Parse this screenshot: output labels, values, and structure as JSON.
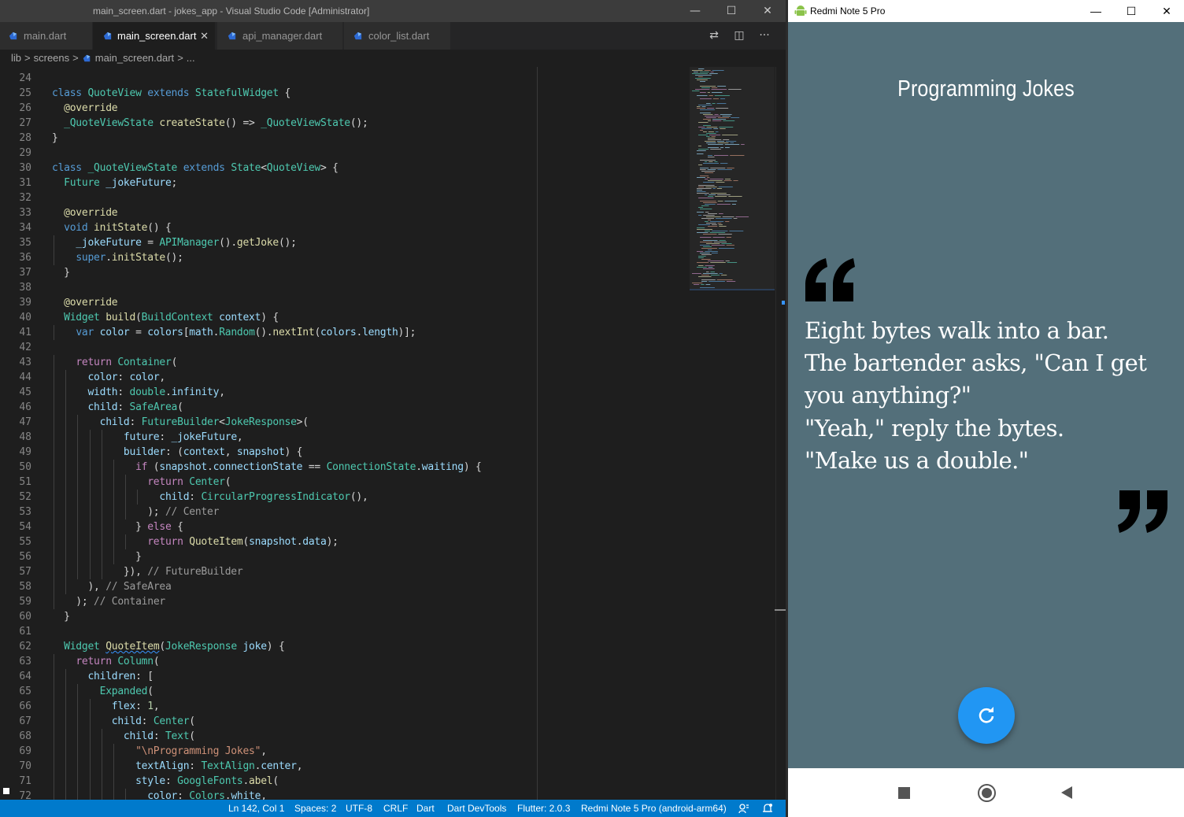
{
  "vscode": {
    "window_title": "main_screen.dart - jokes_app - Visual Studio Code [Administrator]",
    "controls": {
      "minimize": "—",
      "maximize": "☐",
      "close": "✕"
    },
    "tabs": [
      {
        "label": "main.dart",
        "active": false
      },
      {
        "label": "main_screen.dart",
        "active": true,
        "close": "✕"
      },
      {
        "label": "api_manager.dart",
        "active": false
      },
      {
        "label": "color_list.dart",
        "active": false
      }
    ],
    "tab_actions": {
      "compare": "⇄",
      "split": "◫",
      "more": "···"
    },
    "breadcrumb": {
      "folder1": "lib",
      "folder2": "screens",
      "file": "main_screen.dart",
      "tail": "...",
      "sep": ">"
    },
    "status": {
      "position": "Ln 142, Col 1",
      "spaces": "Spaces: 2",
      "encoding": "UTF-8",
      "eol": "CRLF",
      "language": "Dart",
      "devtools": "Dart DevTools",
      "flutter": "Flutter: 2.0.3",
      "device": "Redmi Note 5 Pro (android-arm64)",
      "feedback_icon": "feedback-icon",
      "notifications_icon": "bell-icon"
    },
    "code_lines": [
      {
        "n": "24",
        "html": ""
      },
      {
        "n": "25",
        "html": "<span class=\"kw\">class</span> <span class=\"ty\">QuoteView</span> <span class=\"kw\">extends</span> <span class=\"ty\">StatefulWidget</span> {"
      },
      {
        "n": "26",
        "html": "  <span class=\"an\">@override</span>"
      },
      {
        "n": "27",
        "html": "  <span class=\"ty\">_QuoteViewState</span> <span class=\"fn\">createState</span>() =&gt; <span class=\"ty\">_QuoteViewState</span>();"
      },
      {
        "n": "28",
        "html": "}"
      },
      {
        "n": "29",
        "html": ""
      },
      {
        "n": "30",
        "html": "<span class=\"kw\">class</span> <span class=\"ty\">_QuoteViewState</span> <span class=\"kw\">extends</span> <span class=\"ty\">State</span>&lt;<span class=\"ty\">QuoteView</span>&gt; {"
      },
      {
        "n": "31",
        "html": "  <span class=\"ty\">Future</span> <span class=\"vr\">_jokeFuture</span>;"
      },
      {
        "n": "32",
        "html": ""
      },
      {
        "n": "33",
        "html": "  <span class=\"an\">@override</span>"
      },
      {
        "n": "34",
        "html": "  <span class=\"kw\">void</span> <span class=\"fn\">initState</span>() {"
      },
      {
        "n": "35",
        "html": "    <span class=\"vr\">_jokeFuture</span> = <span class=\"ty\">APIManager</span>().<span class=\"fn\">getJoke</span>();"
      },
      {
        "n": "36",
        "html": "    <span class=\"kw\">super</span>.<span class=\"fn\">initState</span>();"
      },
      {
        "n": "37",
        "html": "  }"
      },
      {
        "n": "38",
        "html": ""
      },
      {
        "n": "39",
        "html": "  <span class=\"an\">@override</span>"
      },
      {
        "n": "40",
        "html": "  <span class=\"ty\">Widget</span> <span class=\"fn\">build</span>(<span class=\"ty\">BuildContext</span> <span class=\"vr\">context</span>) {"
      },
      {
        "n": "41",
        "html": "    <span class=\"kw\">var</span> <span class=\"vr\">color</span> = <span class=\"vr\">colors</span>[<span class=\"vr\">math</span>.<span class=\"ty\">Random</span>().<span class=\"fn\">nextInt</span>(<span class=\"vr\">colors</span>.<span class=\"vr\">length</span>)];"
      },
      {
        "n": "42",
        "html": ""
      },
      {
        "n": "43",
        "html": "    <span class=\"ctl\">return</span> <span class=\"ty\">Container</span>("
      },
      {
        "n": "44",
        "html": "      <span class=\"vr\">color</span>: <span class=\"vr\">color</span>,"
      },
      {
        "n": "45",
        "html": "      <span class=\"vr\">width</span>: <span class=\"ty\">double</span>.<span class=\"vr\">infinity</span>,"
      },
      {
        "n": "46",
        "html": "      <span class=\"vr\">child</span>: <span class=\"ty\">SafeArea</span>("
      },
      {
        "n": "47",
        "html": "        <span class=\"vr\">child</span>: <span class=\"ty\">FutureBuilder</span>&lt;<span class=\"ty\">JokeResponse</span>&gt;("
      },
      {
        "n": "48",
        "html": "            <span class=\"vr\">future</span>: <span class=\"vr\">_jokeFuture</span>,"
      },
      {
        "n": "49",
        "html": "            <span class=\"vr\">builder</span>: (<span class=\"vr\">context</span>, <span class=\"vr\">snapshot</span>) {"
      },
      {
        "n": "50",
        "html": "              <span class=\"ctl\">if</span> (<span class=\"vr\">snapshot</span>.<span class=\"vr\">connectionState</span> == <span class=\"ty\">ConnectionState</span>.<span class=\"vr\">waiting</span>) {"
      },
      {
        "n": "51",
        "html": "                <span class=\"ctl\">return</span> <span class=\"ty\">Center</span>("
      },
      {
        "n": "52",
        "html": "                  <span class=\"vr\">child</span>: <span class=\"ty\">CircularProgressIndicator</span>(),"
      },
      {
        "n": "53",
        "html": "                ); <span class=\"cm\">// Center</span>"
      },
      {
        "n": "54",
        "html": "              } <span class=\"ctl\">else</span> {"
      },
      {
        "n": "55",
        "html": "                <span class=\"ctl\">return</span> <span class=\"fn\">QuoteItem</span>(<span class=\"vr\">snapshot</span>.<span class=\"vr\">data</span>);"
      },
      {
        "n": "56",
        "html": "              }"
      },
      {
        "n": "57",
        "html": "            }), <span class=\"cm\">// FutureBuilder</span>"
      },
      {
        "n": "58",
        "html": "      ), <span class=\"cm\">// SafeArea</span>"
      },
      {
        "n": "59",
        "html": "    ); <span class=\"cm\">// Container</span>"
      },
      {
        "n": "60",
        "html": "  }"
      },
      {
        "n": "61",
        "html": ""
      },
      {
        "n": "62",
        "html": "  <span class=\"ty\">Widget</span> <span class=\"fn squig\">QuoteItem</span>(<span class=\"ty\">JokeResponse</span> <span class=\"vr\">joke</span>) {"
      },
      {
        "n": "63",
        "html": "    <span class=\"ctl\">return</span> <span class=\"ty\">Column</span>("
      },
      {
        "n": "64",
        "html": "      <span class=\"vr\">children</span>: ["
      },
      {
        "n": "65",
        "html": "        <span class=\"ty\">Expanded</span>("
      },
      {
        "n": "66",
        "html": "          <span class=\"vr\">flex</span>: <span class=\"nm\">1</span>,"
      },
      {
        "n": "67",
        "html": "          <span class=\"vr\">child</span>: <span class=\"ty\">Center</span>("
      },
      {
        "n": "68",
        "html": "            <span class=\"vr\">child</span>: <span class=\"ty\">Text</span>("
      },
      {
        "n": "69",
        "html": "              <span class=\"st\">\"\\nProgramming Jokes\"</span>,"
      },
      {
        "n": "70",
        "html": "              <span class=\"vr\">textAlign</span>: <span class=\"ty\">TextAlign</span>.<span class=\"vr\">center</span>,"
      },
      {
        "n": "71",
        "html": "              <span class=\"vr\">style</span>: <span class=\"ty\">GoogleFonts</span>.<span class=\"fn\">abel</span>("
      },
      {
        "n": "72",
        "html": "                <span class=\"vr\">color</span>: <span class=\"ty\">Colors</span>.<span class=\"vr\">white</span>,"
      }
    ]
  },
  "phone": {
    "window_title": "Redmi Note 5 Pro",
    "controls": {
      "minimize": "—",
      "maximize": "☐",
      "close": "✕"
    },
    "app_title": "Programming Jokes",
    "joke_lines": [
      "Eight bytes walk into a bar.",
      "The bartender asks, \"Can I get",
      "you anything?\"",
      "\"Yeah,\" reply the bytes.",
      "\"Make us a double.\""
    ],
    "fab_icon": "refresh-icon",
    "colors": {
      "background": "#536f7a",
      "fab": "#2196f3",
      "text": "#ffffff",
      "quote_marks": "#000000"
    },
    "nav": {
      "recents": "recents-icon",
      "home": "home-icon",
      "back": "back-icon"
    }
  }
}
